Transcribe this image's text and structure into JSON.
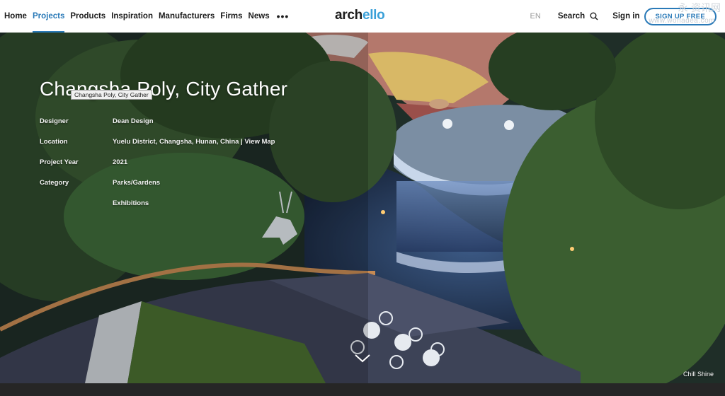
{
  "nav": {
    "items": [
      {
        "label": "Home",
        "active": false
      },
      {
        "label": "Projects",
        "active": true
      },
      {
        "label": "Products",
        "active": false
      },
      {
        "label": "Inspiration",
        "active": false
      },
      {
        "label": "Manufacturers",
        "active": false
      },
      {
        "label": "Firms",
        "active": false
      },
      {
        "label": "News",
        "active": false
      }
    ],
    "more_label": "•••",
    "logo_prefix": "arch",
    "logo_accent": "ello",
    "language": "EN",
    "search_label": "Search",
    "signin_label": "Sign in",
    "signup_label": "SIGN UP FREE",
    "accent_color": "#2a7ab8"
  },
  "watermark": {
    "cn": "永 资讯网",
    "url": "www.wonadea.com"
  },
  "project": {
    "title": "Changsha Poly, City Gather",
    "tooltip": "Changsha Poly, City Gather",
    "details": [
      {
        "label": "Designer",
        "value": "Dean Design"
      },
      {
        "label": "Location",
        "value": "Yuelu District, Changsha, Hunan, China",
        "link": "View Map"
      },
      {
        "label": "Project Year",
        "value": "2021"
      },
      {
        "label": "Category",
        "value": "Parks/Gardens"
      },
      {
        "label": "",
        "value": "Exhibitions"
      }
    ],
    "photo_credit": "Chill Shine"
  }
}
